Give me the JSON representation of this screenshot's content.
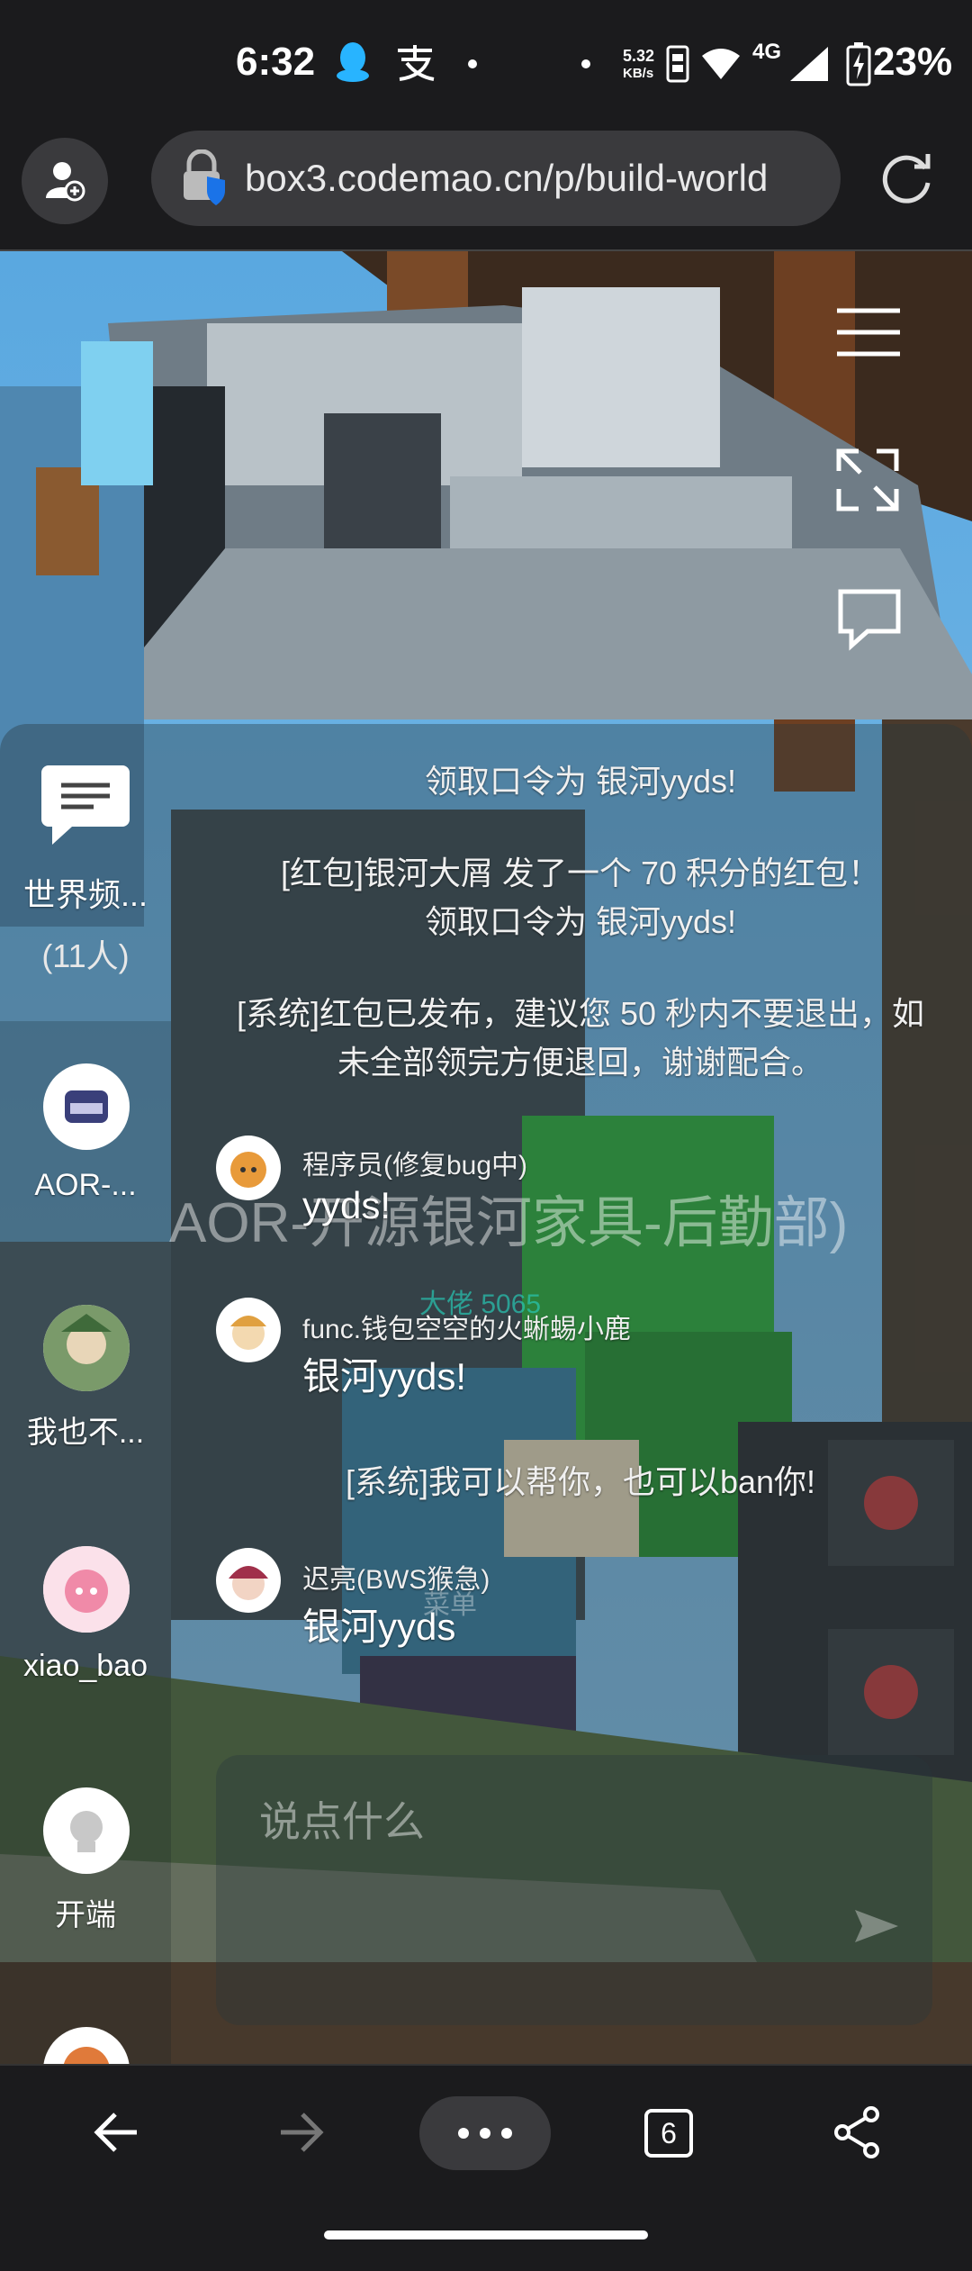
{
  "status_bar": {
    "time": "6:32",
    "net_speed_value": "5.32",
    "net_speed_unit": "KB/s",
    "network": "4G",
    "battery": "23%"
  },
  "browser": {
    "url": "box3.codemao.cn/p/build-world",
    "tab_count": "6"
  },
  "channel": {
    "name": "世界频...",
    "count": "(11人)"
  },
  "players": [
    {
      "name": "AOR-..."
    },
    {
      "name": "我也不..."
    },
    {
      "name": "xiao_bao"
    },
    {
      "name": "开端"
    }
  ],
  "system_messages": [
    "领取口令为 银河yyds!",
    "[红包]银河大屑 发了一个 70 积分的红包！",
    "领取口令为 银河yyds!",
    "[系统]红包已发布，建议您 50 秒内不要退出，如",
    "未全部领完方便退回，谢谢配合。"
  ],
  "messages": [
    {
      "name": "程序员(修复bug中)",
      "text": "yyds!"
    },
    {
      "name": "func.钱包空空的火蜥蜴小鹿",
      "text": "银河yyds!"
    },
    {
      "name": "迟亮(BWS猴急)",
      "text": "银河yyds"
    }
  ],
  "system_message_2": "[系统]我可以帮你，也可以ban你!",
  "ghost": {
    "title": "AOR-开源银河家具-后勤部)",
    "player": "大佬 5065",
    "menu": "菜单"
  },
  "chat_input": {
    "placeholder": "说点什么"
  },
  "colors": {
    "bar_bg": "#1b1b1d",
    "pill_bg": "#3a3a3d",
    "lock_accent": "#1a73e8"
  }
}
